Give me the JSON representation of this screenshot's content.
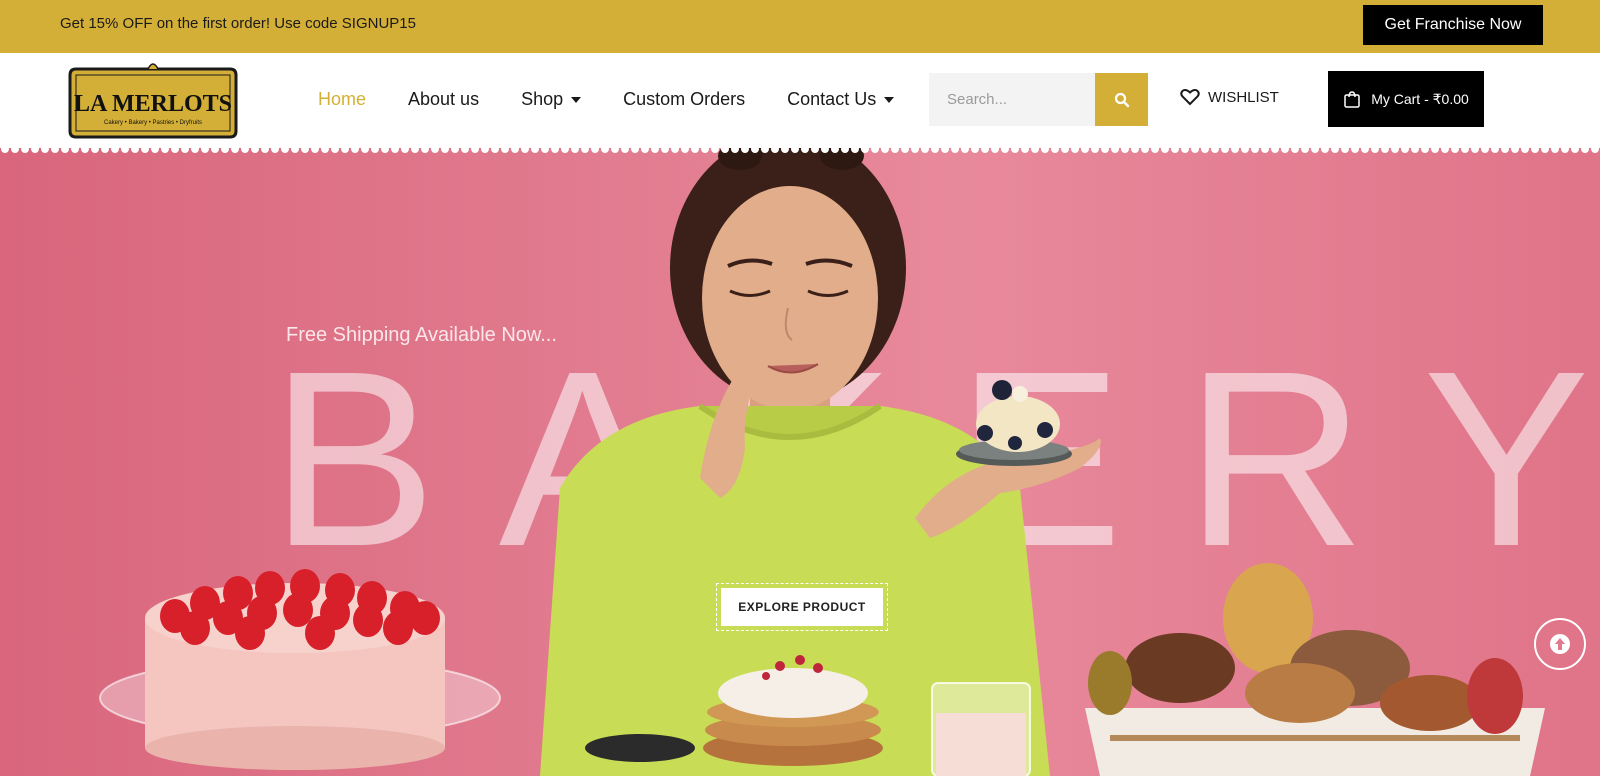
{
  "topbar": {
    "promo": "Get 15% OFF on the first order! Use code SIGNUP15",
    "franchise_label": "Get Franchise Now"
  },
  "logo": {
    "name": "LA MERLOTS",
    "tagline": "Cakery • Bakery • Pastries • Dryfruits"
  },
  "nav": {
    "home": "Home",
    "about": "About us",
    "shop": "Shop",
    "custom": "Custom Orders",
    "contact": "Contact Us"
  },
  "search": {
    "placeholder": "Search..."
  },
  "wishlist": {
    "label": "WISHLIST"
  },
  "cart": {
    "label": "My Cart - ₹0.00"
  },
  "hero": {
    "subtitle": "Free Shipping Available Now...",
    "big_word": "BAKERY",
    "cta": "EXPLORE PRODUCT"
  },
  "colors": {
    "accent": "#d4af37",
    "hero_bg": "#e17a8e",
    "dark": "#000000"
  },
  "icons": [
    "search-icon",
    "heart-icon",
    "bag-icon",
    "arrow-up-icon",
    "caret-down-icon"
  ]
}
